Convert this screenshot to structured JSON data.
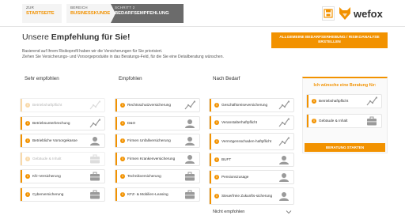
{
  "breadcrumb": [
    {
      "small": "Zur",
      "big": "Startseite"
    },
    {
      "small": "Bereich",
      "big": "Businesskunde"
    },
    {
      "small": "Schritt 2",
      "big": "Bedarfsempfehlung"
    }
  ],
  "brand": {
    "name": "wefox",
    "accent": "#f29200"
  },
  "page": {
    "title_prefix": "Unsere ",
    "title_bold": "Empfehlung für Sie!",
    "intro_line1": "Basierend auf Ihrem Risikoprofil haben wir die Versicherungen für Sie priorisiert.",
    "intro_line2": "Ziehen Sie Versicherungs- und Vorsorgeprodukte in das Beratungs-Feld, für die Sie eine Detailberatung wünschen.",
    "analysis_button": "Allgemeine Bedarfserhebung / Risikoanalyse erstellen"
  },
  "columns": {
    "strongly": {
      "heading": "Sehr empfohlen",
      "items": [
        {
          "label": "Betriebshaftpflicht",
          "icon": "chart-icon",
          "muted": true
        },
        {
          "label": "Betriebsunterbrechung",
          "icon": "chart-icon",
          "muted": false
        },
        {
          "label": "Betriebliche Vorsorgekasse",
          "icon": "person-icon",
          "muted": false
        },
        {
          "label": "Gebäude & Inhalt",
          "icon": "briefcase-icon",
          "muted": true
        },
        {
          "label": "Kfz-Versicherung",
          "icon": "briefcase-icon",
          "muted": false
        },
        {
          "label": "Cyberversicherung",
          "icon": "briefcase-icon",
          "muted": false
        }
      ]
    },
    "recommended": {
      "heading": "Empfohlen",
      "items": [
        {
          "label": "Rechtsschutzversicherung",
          "icon": "chart-icon",
          "muted": false
        },
        {
          "label": "D&O",
          "icon": "person-icon",
          "muted": false
        },
        {
          "label": "Firmen Unfallversicherung",
          "icon": "person-icon",
          "muted": false
        },
        {
          "label": "Firmen Krankenversicherung",
          "icon": "person-icon",
          "muted": false
        },
        {
          "label": "Technikversicherung",
          "icon": "briefcase-icon",
          "muted": false
        },
        {
          "label": "KFZ- & Mobilien-Leasing",
          "icon": "briefcase-icon",
          "muted": false
        }
      ]
    },
    "as_needed": {
      "heading": "Nach Bedarf",
      "items": [
        {
          "label": "Geschäftsreiseversicherung",
          "icon": "chart-icon",
          "muted": false
        },
        {
          "label": "Veranstalterhaftpflicht",
          "icon": "chart-icon",
          "muted": false
        },
        {
          "label": "Vermögensschaden-haftpflicht",
          "icon": "chart-icon",
          "muted": false
        },
        {
          "label": "BUFT",
          "icon": "person-icon",
          "muted": false
        },
        {
          "label": "Pensionszusage",
          "icon": "person-icon",
          "muted": false
        },
        {
          "label": "Steuerfreie Zukunfts-sicherung",
          "icon": "person-icon",
          "muted": false
        }
      ]
    },
    "not_recommended": {
      "heading": "Nicht empfohlen"
    }
  },
  "consultation": {
    "title": "Ich wünsche eine Beratung für:",
    "items": [
      {
        "label": "Betriebshaftpflicht",
        "icon": "chart-icon"
      },
      {
        "label": "Gebäude & Inhalt",
        "icon": "briefcase-icon"
      }
    ],
    "button": "Beratung starten"
  }
}
